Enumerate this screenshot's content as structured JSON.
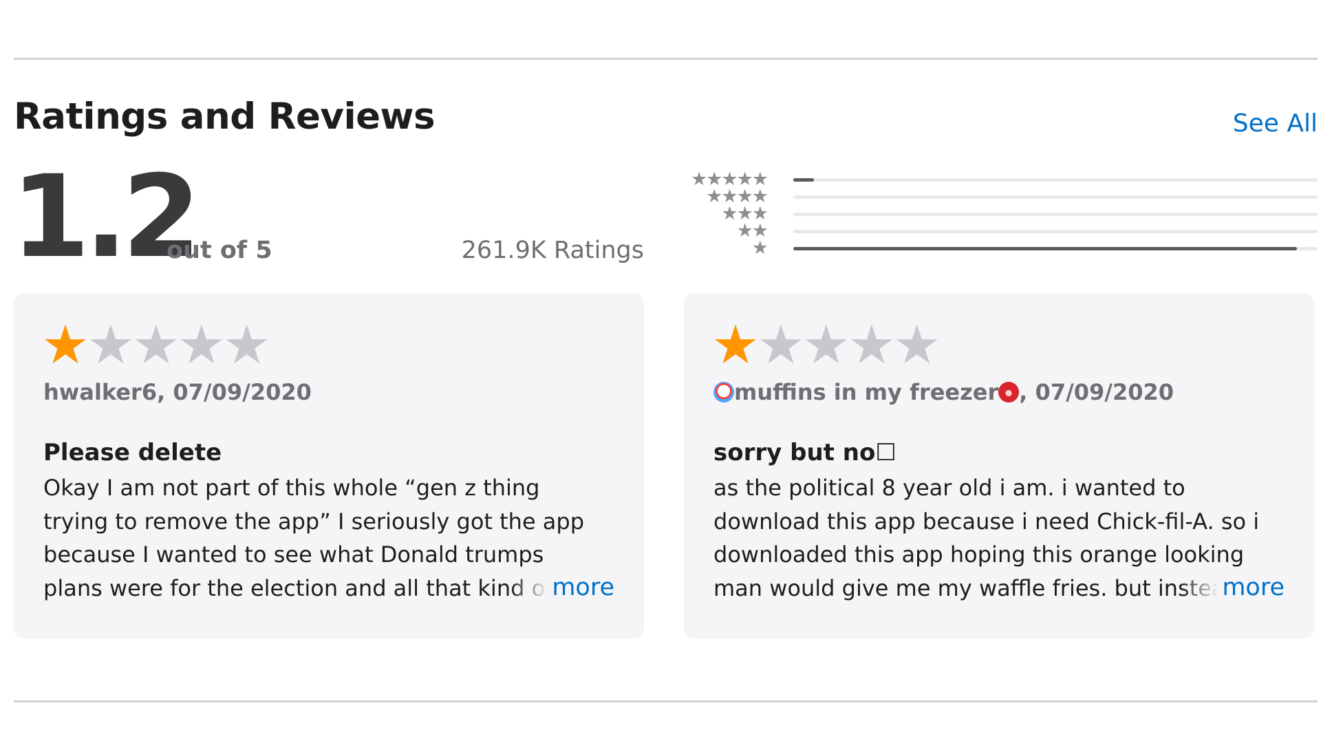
{
  "section": {
    "title": "Ratings and Reviews",
    "see_all_label": "See All"
  },
  "summary": {
    "score": "1.2",
    "out_of": "out of 5",
    "ratings_count": "261.9K Ratings"
  },
  "histogram": [
    {
      "stars": "★★★★★",
      "fraction": 0.04
    },
    {
      "stars": "★★★★",
      "fraction": 0.0
    },
    {
      "stars": "★★★",
      "fraction": 0.0
    },
    {
      "stars": "★★",
      "fraction": 0.0
    },
    {
      "stars": "★",
      "fraction": 0.96
    }
  ],
  "reviews": [
    {
      "rating": 1,
      "author": "hwalker6",
      "date": "07/09/2020",
      "title": "Please delete",
      "body_lines": [
        "Okay I am not part of this whole “gen z thing",
        "trying to remove the app” I seriously got the app",
        "because I wanted to see what Donald trumps",
        "plans were for the election and all that kind of"
      ],
      "more_label": "more"
    },
    {
      "rating": 1,
      "author_prefix_emoji": "clown-face",
      "author": "muffins in my freezer",
      "author_suffix_emoji": "ogre-face",
      "date": "07/09/2020",
      "title": "sorry but no☐",
      "body_lines": [
        "as the political 8 year old i am. i wanted to",
        "download this app because i need Chick-fil-A. so i",
        "downloaded this app hoping this orange looking",
        "man would give me my waffle fries. but instead"
      ],
      "more_label": "more"
    }
  ],
  "colors": {
    "accent": "#0070c9",
    "star_filled": "#ff9500",
    "star_empty": "#c7c7cc",
    "card_bg": "#f5f5f7"
  }
}
